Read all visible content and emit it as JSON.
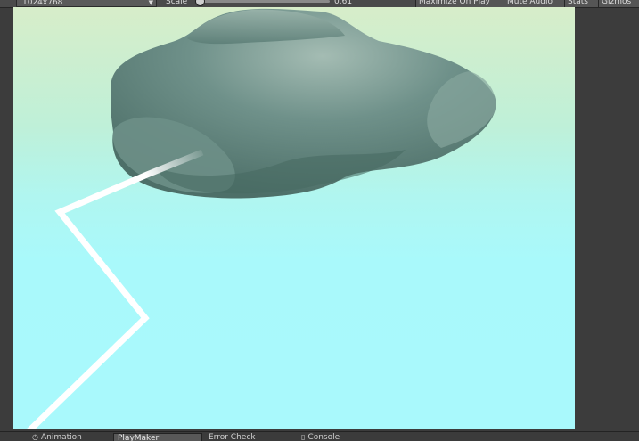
{
  "toolbar": {
    "resolution": "1024x768",
    "scale_label": "Scale",
    "scale_value": "0.61",
    "scale_fraction": 0.02,
    "maximize_on_play": "Maximize On Play",
    "mute_audio": "Mute Audio",
    "stats": "Stats",
    "gizmos": "Gizmos"
  },
  "tabs": {
    "animation": "Animation",
    "playmaker": "PlayMaker",
    "error_check": "Error Check",
    "console": "Console"
  },
  "scene": {
    "sky_top_color": "#d7edc9",
    "sky_bottom_color": "#a9f9fc",
    "cloud_color": "#5f8278",
    "lightning_color": "#ffffff"
  },
  "colors": {
    "editor_background": "#3c3c3c",
    "toolbar_background": "#4a4a4a"
  }
}
